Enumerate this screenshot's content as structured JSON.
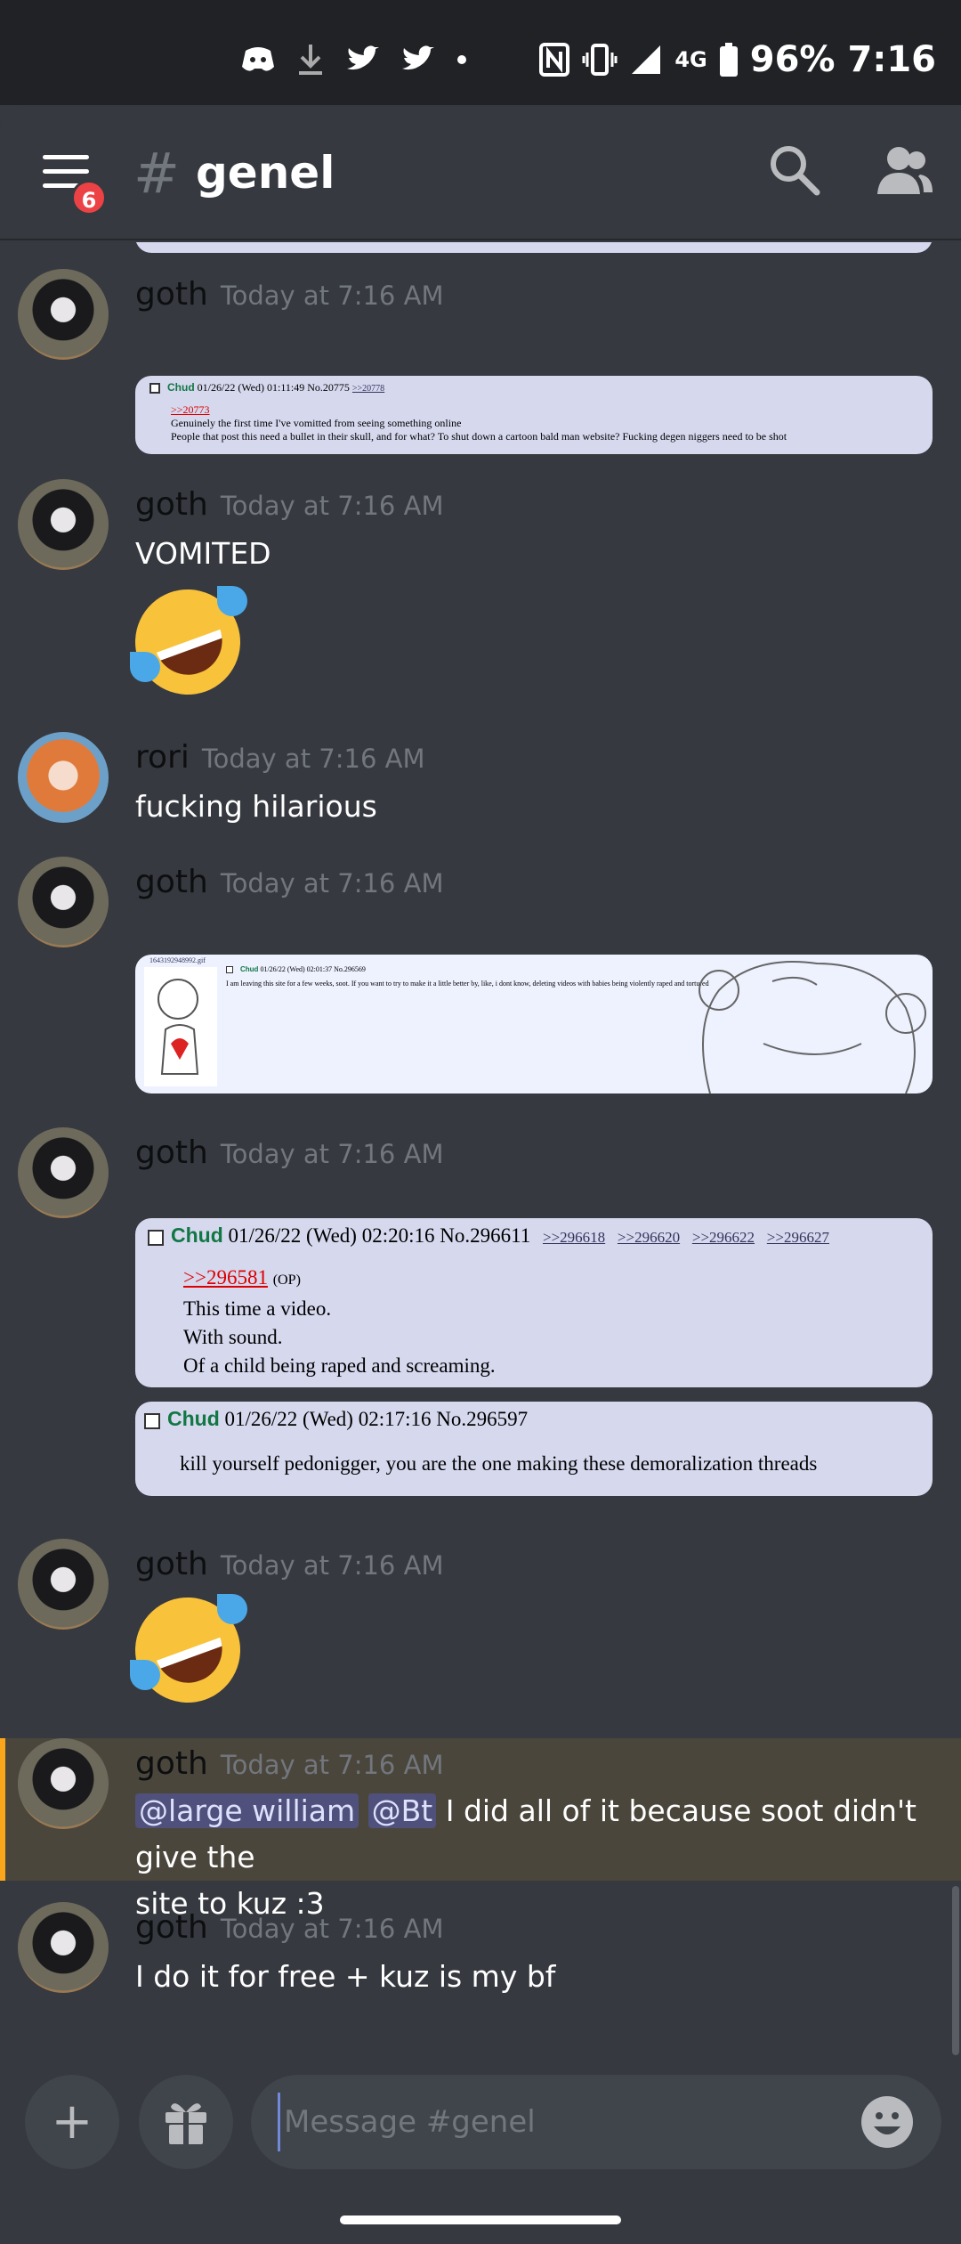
{
  "status_bar": {
    "icons": [
      "discord-icon",
      "download-icon",
      "twitter-icon",
      "twitter-icon",
      "dot-icon"
    ],
    "right_icons": [
      "nfc-icon",
      "vibrate-icon",
      "signal-icon",
      "4g-icon",
      "battery-icon"
    ],
    "network": "4G",
    "battery": "96%",
    "time": "7:16"
  },
  "header": {
    "menu_badge": "6",
    "hash": "#",
    "channel": "genel"
  },
  "messages": [
    {
      "author": "goth",
      "timestamp": "Today at 7:16 AM",
      "embed": {
        "name": "Chud",
        "meta": "01/26/22 (Wed) 01:11:49 No.20775",
        "backlinks": [
          ">>20778"
        ],
        "quote": ">>20773",
        "lines": [
          "Genuinely the first time I've vomitted from seeing something online",
          "People that post this need a bullet in their skull, and for what? To shut down a cartoon bald man website? Fucking degen niggers need to be shot"
        ]
      }
    },
    {
      "author": "goth",
      "timestamp": "Today at 7:16 AM",
      "text": "VOMITED",
      "emoji": "rolling-on-floor-laughing"
    },
    {
      "author": "rori",
      "timestamp": "Today at 7:16 AM",
      "text": "fucking hilarious"
    },
    {
      "author": "goth",
      "timestamp": "Today at 7:16 AM",
      "embed": {
        "file": "1643192948992.gif",
        "name": "Chud",
        "meta": "01/26/22 (Wed) 02:01:37 No.296569",
        "text": "I am leaving this site for a few weeks, soot. If you want to try to make it a little better by, like, i dont know, deleting videos with babies being violently raped and tortured"
      }
    },
    {
      "author": "goth",
      "timestamp": "Today at 7:16 AM",
      "embeds": [
        {
          "name": "Chud",
          "meta": "01/26/22 (Wed) 02:20:16 No.296611",
          "backlinks": [
            ">>296618",
            ">>296620",
            ">>296622",
            ">>296627"
          ],
          "quote": ">>296581",
          "op": "(OP)",
          "lines": [
            "This time a video.",
            "With sound.",
            "Of a child being raped and screaming."
          ]
        },
        {
          "name": "Chud",
          "meta": "01/26/22 (Wed) 02:17:16 No.296597",
          "lines": [
            "kill yourself pedonigger, you are the one making these demoralization threads"
          ]
        }
      ]
    },
    {
      "author": "goth",
      "timestamp": "Today at 7:16 AM",
      "emoji": "rolling-on-floor-laughing"
    },
    {
      "author": "goth",
      "timestamp": "Today at 7:16 AM",
      "mentions": [
        "@large william",
        "@Bt"
      ],
      "text_line1": " I did all of it because soot didn't give the",
      "text_line2": "site to kuz :3",
      "highlighted": true
    },
    {
      "author": "goth",
      "timestamp": "Today at 7:16 AM",
      "text": "I do it for free + kuz is my bf"
    }
  ],
  "composer": {
    "placeholder": "Message #genel",
    "plus_label": "+",
    "gift_icon": "gift-icon",
    "emoji_icon": "emoji-icon"
  }
}
